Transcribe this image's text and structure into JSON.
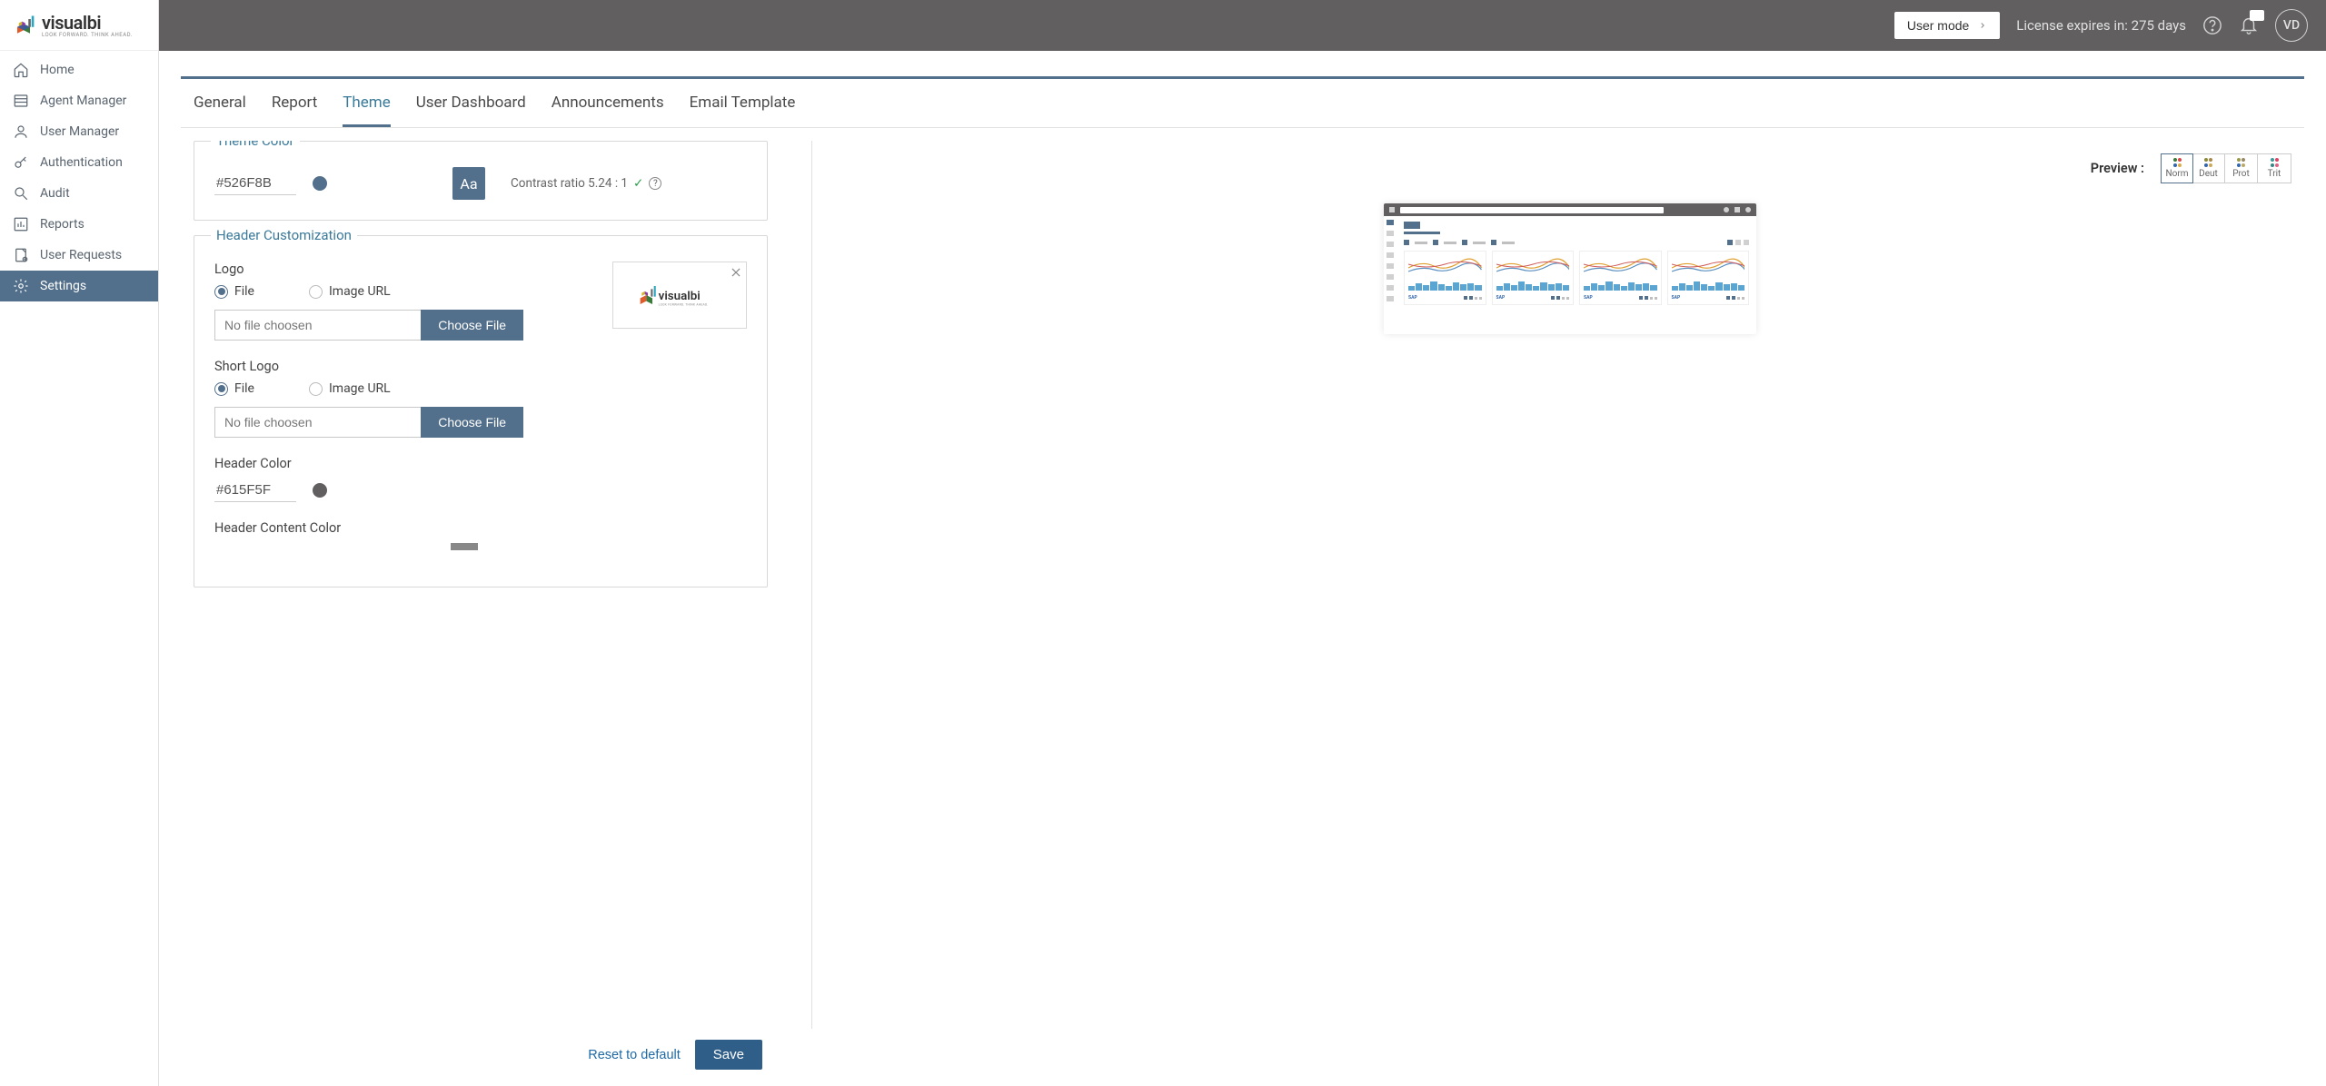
{
  "brand": {
    "name": "visualbi",
    "tagline": "LOOK FORWARD. THINK AHEAD."
  },
  "header": {
    "user_mode": "User mode",
    "license": "License expires in: 275 days",
    "avatar_initials": "VD"
  },
  "sidebar": {
    "items": [
      {
        "label": "Home",
        "icon": "home"
      },
      {
        "label": "Agent Manager",
        "icon": "list"
      },
      {
        "label": "User Manager",
        "icon": "user"
      },
      {
        "label": "Authentication",
        "icon": "key"
      },
      {
        "label": "Audit",
        "icon": "search"
      },
      {
        "label": "Reports",
        "icon": "chart"
      },
      {
        "label": "User Requests",
        "icon": "request"
      },
      {
        "label": "Settings",
        "icon": "gear"
      }
    ],
    "active_index": 7
  },
  "tabs": {
    "items": [
      "General",
      "Report",
      "Theme",
      "User Dashboard",
      "Announcements",
      "Email Template"
    ],
    "active_index": 2
  },
  "theme_section": {
    "legend": "Theme Color",
    "hex": "#526F8B",
    "aa": "Aa",
    "contrast_label": "Contrast ratio 5.24 : 1"
  },
  "header_section": {
    "legend": "Header Customization",
    "logo_label": "Logo",
    "short_logo_label": "Short Logo",
    "radio_file": "File",
    "radio_url": "Image URL",
    "file_placeholder": "No file choosen",
    "choose_file": "Choose File",
    "header_color_label": "Header Color",
    "header_color_hex": "#615F5F",
    "header_content_label": "Header Content Color"
  },
  "actions": {
    "reset": "Reset to default",
    "save": "Save"
  },
  "preview": {
    "label": "Preview :",
    "color_blind_options": [
      "Norm",
      "Deut",
      "Prot",
      "Trit"
    ],
    "active_cb": 0
  },
  "colors": {
    "theme": "#526f8b",
    "header": "#615f5f"
  }
}
